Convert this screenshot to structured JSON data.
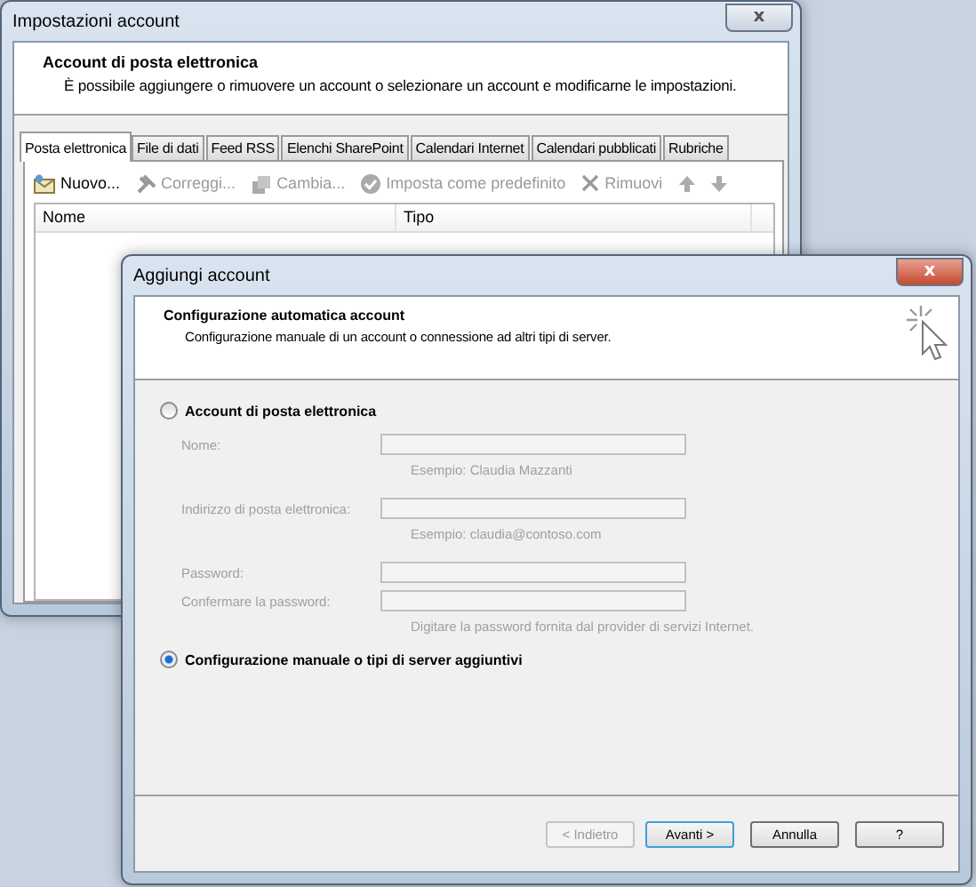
{
  "settings_window": {
    "title": "Impostazioni account",
    "close": "x",
    "header": {
      "title": "Account di posta elettronica",
      "description": "È possibile aggiungere o rimuovere un account o selezionare un account e modificarne le impostazioni."
    },
    "tabs": [
      {
        "label": "Posta elettronica",
        "selected": true
      },
      {
        "label": "File di dati",
        "selected": false
      },
      {
        "label": "Feed RSS",
        "selected": false
      },
      {
        "label": "Elenchi SharePoint",
        "selected": false
      },
      {
        "label": "Calendari Internet",
        "selected": false
      },
      {
        "label": "Calendari pubblicati",
        "selected": false
      },
      {
        "label": "Rubriche",
        "selected": false
      }
    ],
    "toolbar": [
      {
        "kind": "new",
        "label": "Nuovo...",
        "disabled": false
      },
      {
        "kind": "repair",
        "label": "Correggi...",
        "disabled": true
      },
      {
        "kind": "change",
        "label": "Cambia...",
        "disabled": true
      },
      {
        "kind": "default",
        "label": "Imposta come predefinito",
        "disabled": true
      },
      {
        "kind": "remove",
        "label": "Rimuovi",
        "disabled": true
      },
      {
        "kind": "up",
        "disabled": true
      },
      {
        "kind": "down",
        "disabled": true
      }
    ],
    "columns": [
      "Nome",
      "Tipo"
    ]
  },
  "add_window": {
    "title": "Aggiungi account",
    "close": "x",
    "header": {
      "title": "Configurazione automatica account",
      "description": "Configurazione manuale di un account o connessione ad altri tipi di server."
    },
    "options": [
      {
        "label": "Account di posta elettronica",
        "selected": false
      },
      {
        "label": "Configurazione manuale o tipi di server aggiuntivi",
        "selected": true
      }
    ],
    "fields": [
      {
        "label": "Nome:",
        "note": "Esempio: Claudia Mazzanti",
        "disabled": true
      },
      {
        "label": "Indirizzo di posta elettronica:",
        "note": "Esempio: claudia@contoso.com",
        "disabled": true
      },
      {
        "label": "Password:",
        "disabled": true
      },
      {
        "label": "Confermare la password:",
        "note": "Digitare la password fornita dal provider di servizi Internet.",
        "disabled": true
      }
    ],
    "buttons": [
      {
        "label": "< Indietro",
        "disabled": true,
        "default": false
      },
      {
        "label": "Avanti >",
        "disabled": false,
        "default": true
      },
      {
        "label": "Annulla",
        "disabled": false,
        "default": false
      },
      {
        "label": "?",
        "disabled": false,
        "default": false
      }
    ]
  }
}
